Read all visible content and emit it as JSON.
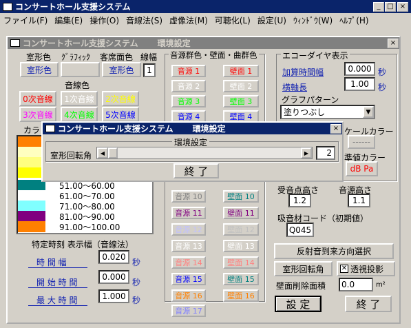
{
  "app": {
    "title": "コンサートホール支援システム",
    "controls": [
      "_",
      "□",
      "×"
    ]
  },
  "menu": [
    "ファイル(F)",
    "編集(E)",
    "操作(O)",
    "音線法(S)",
    "虚像法(M)",
    "可聴化(L)",
    "設定(U)",
    "ｳｨﾝﾄﾞｳ(W)",
    "ﾍﾙﾌﾟ(H)"
  ],
  "env": {
    "app_title": "コンサートホール支援システム",
    "title": "環境設定",
    "close": "×",
    "room_color_head": "室形色",
    "graphic_head": "ｸﾞﾗﾌｨｯｸ",
    "audience_head": "客席面色",
    "line_width_head": "線幅",
    "room_color_btn": "室形色",
    "audience_btn": "室形色",
    "line_width": "1",
    "ray_color_head": "音線色",
    "rays": [
      "0次音線",
      "1次音線",
      "2次音線",
      "3次音線",
      "4次音線",
      "5次音線"
    ],
    "ray_colors": [
      "#ff0000",
      "#ffffff",
      "#ffff00",
      "#ff00ff",
      "#00ff00",
      "#0000ff"
    ],
    "color_head": "カラ",
    "scale": [
      "51.00～60.00",
      "61.00～70.00",
      "71.00～80.00",
      "81.00～90.00",
      "91.00～100.00"
    ],
    "scale_colors": [
      "#ff8000",
      "#ffffc0",
      "#ffff80",
      "#ffff00",
      "#008080",
      "#ffffff",
      "#80ffff",
      "#800080",
      "#ff8000"
    ],
    "time_head": "特定時刻 表示幅（音線法）",
    "time_width_label": "時 間 幅",
    "time_width": "0.020",
    "start_label": "開 始 時 間",
    "start": "0.000",
    "max_label": "最 大 時 間",
    "max": "1.000",
    "sec": "秒",
    "src_head": "音源群色・壁面・曲群色",
    "sources": [
      "音源 1",
      "音源 2",
      "音源 3",
      "音源 4",
      "音源 10",
      "音源 11",
      "音源 12",
      "音源 13",
      "音源 14",
      "音源 15",
      "音源 16",
      "音源 17"
    ],
    "walls": [
      "壁面 1",
      "壁面 2",
      "壁面 3",
      "壁面 4",
      "壁面 10",
      "壁面 11",
      "壁面 12",
      "壁面 13",
      "壁面 14",
      "壁面 15",
      "壁面 16"
    ],
    "src_colors": [
      "#ff0000",
      "#ffffff",
      "#00ff00",
      "#0000ff",
      "#808080",
      "#800080",
      "#c0c0ff",
      "#ffffff",
      "#ff8080",
      "#0000ff",
      "#ff8000",
      "#8080ff"
    ],
    "wall_colors": [
      "#ff0000",
      "#ffffff",
      "#00ff00",
      "#0000ff",
      "#008080",
      "#800080",
      "#c0c0c0",
      "#ffffff",
      "#ff8080",
      "#008080",
      "#ff8000"
    ],
    "echo_head": "エコーダイヤ表示",
    "interval_label": "加算時間幅",
    "interval": "0.000",
    "axis_label": "横軸長",
    "axis": "1.00",
    "graph_pattern_label": "グラフパターン",
    "graph_pattern": "塗りつぶし",
    "scale_color_label": "ケールカラー",
    "ref_color_label": "準値カラー",
    "ref_value": "dB Pa",
    "recv_height_label": "受音点高さ",
    "recv_height": "1.2",
    "src_height_label": "音源高さ",
    "src_height": "1.1",
    "absorb_label": "吸音材コード（初期値）",
    "absorb": "Q045",
    "reflect_btn": "反射音到来方向選択",
    "rotate_btn": "室形回転角",
    "persp_label": "透視投影",
    "persp_checked": true,
    "wall_del_label": "壁面削除面積",
    "wall_del": "0.0",
    "m2": "m²",
    "ok": "設 定",
    "end": "終 了"
  },
  "dialog": {
    "app_title": "コンサートホール支援システム",
    "title": "環境設定",
    "close": "×",
    "group": "環境設定",
    "rotation_label": "室形回転角",
    "rotation_value": "2",
    "end": "終 了"
  }
}
